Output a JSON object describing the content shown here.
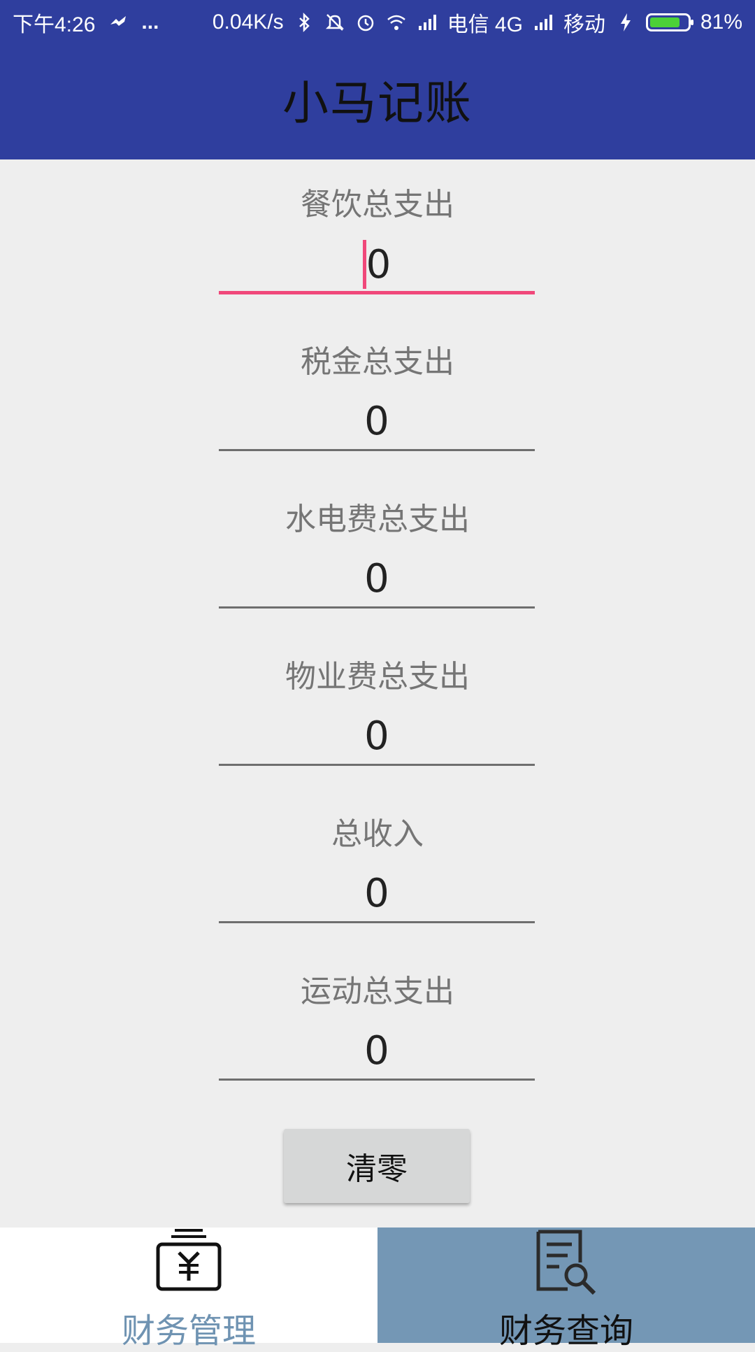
{
  "status_bar": {
    "time": "下午4:26",
    "more": "...",
    "net_speed": "0.04K/s",
    "carrier1": "电信 4G",
    "carrier2": "移动",
    "battery_percent": "81%",
    "battery_level": 0.81
  },
  "app": {
    "title": "小马记账"
  },
  "fields": [
    {
      "label": "餐饮总支出",
      "value": "0",
      "focused": true
    },
    {
      "label": "税金总支出",
      "value": "0"
    },
    {
      "label": "水电费总支出",
      "value": "0"
    },
    {
      "label": "物业费总支出",
      "value": "0"
    },
    {
      "label": "总收入",
      "value": "0"
    },
    {
      "label": "运动总支出",
      "value": "0"
    }
  ],
  "clear_button": {
    "label": "清零"
  },
  "bottom_nav": {
    "tabs": [
      {
        "label": "财务管理",
        "icon": "wallet-yuan-icon",
        "selected": false
      },
      {
        "label": "财务查询",
        "icon": "document-search-icon",
        "selected": true
      }
    ]
  },
  "colors": {
    "primary": "#2f3e9e",
    "accent": "#f0487a",
    "tab_selected_bg": "#7497b5",
    "tab_label_blue": "#6f93b2"
  }
}
